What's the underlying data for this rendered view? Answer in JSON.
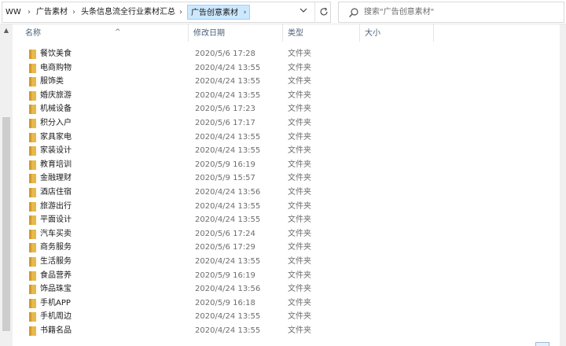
{
  "address_bar": {
    "crumbs": [
      "WW",
      "广告素材",
      "头条信息流全行业素材汇总"
    ],
    "current": "广告创意素材"
  },
  "search": {
    "placeholder": "搜索\"广告创意素材\""
  },
  "columns": {
    "name": "名称",
    "date": "修改日期",
    "type": "类型",
    "size": "大小"
  },
  "files": [
    {
      "name": "餐饮美食",
      "date": "2020/5/6 17:28",
      "type": "文件夹"
    },
    {
      "name": "电商购物",
      "date": "2020/4/24 13:55",
      "type": "文件夹"
    },
    {
      "name": "服饰类",
      "date": "2020/4/24 13:55",
      "type": "文件夹"
    },
    {
      "name": "婚庆旅游",
      "date": "2020/4/24 13:55",
      "type": "文件夹"
    },
    {
      "name": "机械设备",
      "date": "2020/5/6 17:23",
      "type": "文件夹"
    },
    {
      "name": "积分入户",
      "date": "2020/5/6 17:17",
      "type": "文件夹"
    },
    {
      "name": "家具家电",
      "date": "2020/4/24 13:55",
      "type": "文件夹"
    },
    {
      "name": "家装设计",
      "date": "2020/4/24 13:55",
      "type": "文件夹"
    },
    {
      "name": "教育培训",
      "date": "2020/5/9 16:19",
      "type": "文件夹"
    },
    {
      "name": "金融理财",
      "date": "2020/5/9 15:57",
      "type": "文件夹"
    },
    {
      "name": "酒店住宿",
      "date": "2020/4/24 13:56",
      "type": "文件夹"
    },
    {
      "name": "旅游出行",
      "date": "2020/4/24 13:55",
      "type": "文件夹"
    },
    {
      "name": "平面设计",
      "date": "2020/4/24 13:55",
      "type": "文件夹"
    },
    {
      "name": "汽车买卖",
      "date": "2020/5/6 17:24",
      "type": "文件夹"
    },
    {
      "name": "商务服务",
      "date": "2020/5/6 17:29",
      "type": "文件夹"
    },
    {
      "name": "生活服务",
      "date": "2020/4/24 13:55",
      "type": "文件夹"
    },
    {
      "name": "食品营养",
      "date": "2020/5/9 16:19",
      "type": "文件夹"
    },
    {
      "name": "饰品珠宝",
      "date": "2020/4/24 13:56",
      "type": "文件夹"
    },
    {
      "name": "手机APP",
      "date": "2020/5/9 16:18",
      "type": "文件夹"
    },
    {
      "name": "手机周边",
      "date": "2020/4/24 13:55",
      "type": "文件夹"
    },
    {
      "name": "书籍名品",
      "date": "2020/4/24 13:55",
      "type": "文件夹"
    }
  ],
  "colors": {
    "folder": "#e8b84a",
    "selected_crumb": "#cce8ff",
    "header_text": "#4c607a"
  },
  "icons": {
    "folder": "folder-icon",
    "search": "search-icon",
    "refresh": "refresh-icon",
    "dropdown": "chevron-down-icon"
  }
}
